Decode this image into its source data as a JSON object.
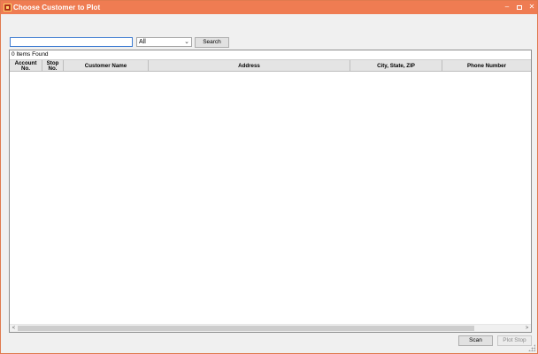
{
  "window": {
    "title": "Choose Customer to Plot"
  },
  "titlebar": {
    "minimize": "–",
    "close": "✕"
  },
  "search": {
    "value": "",
    "filter": "All",
    "filter_chevron": "⌄",
    "button": "Search"
  },
  "list": {
    "count_text": "0 Items Found",
    "columns": [
      "Account No.",
      "Stop No.",
      "Customer Name",
      "Address",
      "City, State, ZIP",
      "Phone Number"
    ],
    "rows": [],
    "scroll_left": "<",
    "scroll_right": ">"
  },
  "footer": {
    "scan": "Scan",
    "plot": "Plot Stop"
  }
}
